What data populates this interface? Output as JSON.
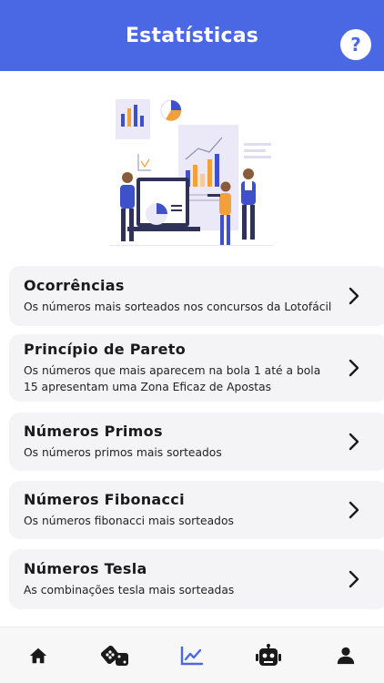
{
  "header": {
    "title": "Estatísticas",
    "help_label": "?"
  },
  "cards": [
    {
      "title": "Ocorrências",
      "description": "Os números mais sorteados nos concursos da Lotofácil"
    },
    {
      "title": "Princípio de Pareto",
      "description": "Os números que mais aparecem na bola 1 até a bola 15 apresentam uma Zona Eficaz de Apostas"
    },
    {
      "title": "Números Primos",
      "description": "Os números primos mais sorteados"
    },
    {
      "title": "Números Fibonacci",
      "description": "Os números fibonacci mais sorteados"
    },
    {
      "title": "Números Tesla",
      "description": "As combinações tesla mais sorteadas"
    }
  ],
  "bottom_nav": [
    {
      "icon": "home-icon",
      "active": false
    },
    {
      "icon": "dice-icon",
      "active": false
    },
    {
      "icon": "chart-line-icon",
      "active": true
    },
    {
      "icon": "robot-icon",
      "active": false
    },
    {
      "icon": "user-icon",
      "active": false
    }
  ],
  "colors": {
    "primary": "#4a68e4",
    "nav_inactive": "#1a1a1a",
    "card_bg": "#f4f4f6"
  }
}
